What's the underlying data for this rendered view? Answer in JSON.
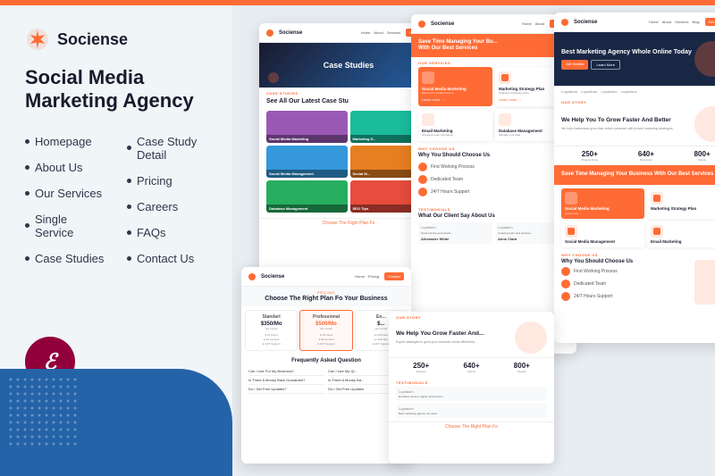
{
  "topBar": {},
  "sidebar": {
    "logo": "Sociense",
    "title": "Social Media Marketing Agency",
    "nav": {
      "col1": [
        {
          "label": "Homepage"
        },
        {
          "label": "About Us"
        },
        {
          "label": "Our Services"
        },
        {
          "label": "Single Service"
        },
        {
          "label": "Case Studies"
        }
      ],
      "col2": [
        {
          "label": "Case Study Detail"
        },
        {
          "label": "Pricing"
        },
        {
          "label": "Careers"
        },
        {
          "label": "FAQs"
        },
        {
          "label": "Contact Us"
        }
      ]
    }
  },
  "previews": {
    "caseStudies": {
      "label": "CASE STUDIES",
      "heroTitle": "Case Studies",
      "seeAll": "See All Our Latest Case Stu",
      "items": [
        {
          "title": "Social Media Marketing",
          "color": "purple"
        },
        {
          "title": "Marketing S...",
          "color": "teal"
        },
        {
          "title": "Social Media Management",
          "color": "blue"
        },
        {
          "title": "Social M...",
          "color": "orange"
        },
        {
          "title": "Database Management",
          "color": "green"
        },
        {
          "title": "SEO Tips",
          "color": "red"
        }
      ]
    },
    "homepage": {
      "heroTitle": "Save Time Managing Your Bu... With Our Best Services",
      "serviceLabel": "SERVICES",
      "whyLabel": "WHY CHOOSE US",
      "whyTitle": "Why You Should Choose Us",
      "whyItems": [
        {
          "text": "First Working Process"
        },
        {
          "text": "Dedicated Team"
        },
        {
          "text": "24/7 Hours Support"
        }
      ],
      "testimonialTitle": "What Our Client Say About Us"
    },
    "marketing": {
      "heroTitle": "Best Marketing Agency Whole Online Today",
      "growTitle": "We Help You To Grow Faster And Better",
      "stats": [
        {
          "num": "250+",
          "label": "Projects Done"
        },
        {
          "num": "640+",
          "label": "Production"
        },
        {
          "num": "800+",
          "label": ""
        }
      ],
      "saveSectionTitle": "Save Time Managing Your Business With Our Best Services",
      "whyTitle": "Why You Should Choose Us"
    },
    "pricing": {
      "label": "PRICING",
      "title": "Choose The Right Plan Fo Your Business",
      "plans": [
        {
          "name": "Standart",
          "price": "$350/Mo"
        },
        {
          "name": "Professional",
          "price": "$500/Mo",
          "active": true
        },
        {
          "name": "En...",
          "price": "$..."
        }
      ],
      "faqTitle": "Frequently Asked Question",
      "testimonialTitle": "What Our Client Say About Us"
    }
  }
}
